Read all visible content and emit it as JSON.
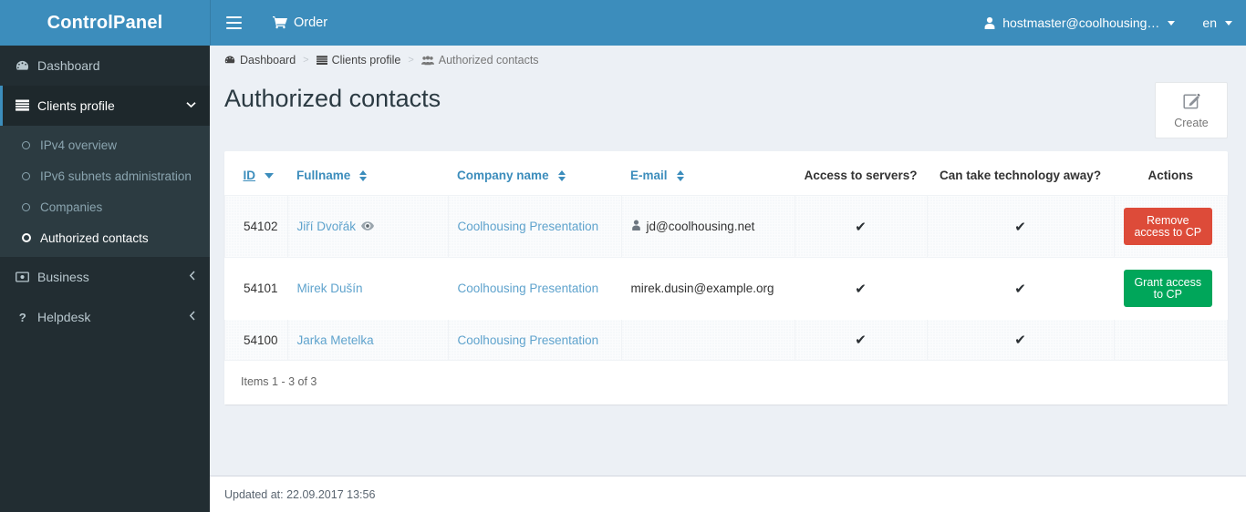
{
  "brand": {
    "title": "ControlPanel"
  },
  "navbar": {
    "menu_toggle": "menu-toggle",
    "order_label": "Order",
    "user_label": "hostmaster@coolhousing…",
    "lang_label": "en"
  },
  "sidebar": {
    "items": [
      {
        "label": "Dashboard",
        "icon": "dashboard-icon",
        "active": false
      },
      {
        "label": "Clients profile",
        "icon": "server-list-icon",
        "active": true,
        "arrow": "chevron-down"
      },
      {
        "label": "Business",
        "icon": "money-icon",
        "active": false,
        "arrow": "chevron-left"
      },
      {
        "label": "Helpdesk",
        "icon": "question-icon",
        "active": false,
        "arrow": "chevron-left"
      }
    ],
    "submenu": [
      {
        "label": "IPv4 overview",
        "active": false
      },
      {
        "label": "IPv6 subnets administration",
        "active": false
      },
      {
        "label": "Companies",
        "active": false
      },
      {
        "label": "Authorized contacts",
        "active": true
      }
    ]
  },
  "breadcrumb": [
    {
      "label": "Dashboard",
      "icon": "dashboard-icon"
    },
    {
      "label": "Clients profile",
      "icon": "server-list-icon"
    },
    {
      "label": "Authorized contacts",
      "icon": "users-group-icon"
    }
  ],
  "page": {
    "title": "Authorized contacts",
    "create_label": "Create"
  },
  "table": {
    "columns": [
      {
        "label": "ID",
        "sort": "desc",
        "align": "left",
        "underline": true
      },
      {
        "label": "Fullname",
        "sort": "both",
        "align": "left"
      },
      {
        "label": "Company name",
        "sort": "both",
        "align": "left"
      },
      {
        "label": "E-mail",
        "sort": "both",
        "align": "left"
      },
      {
        "label": "Access to servers?",
        "sort": "none",
        "align": "center"
      },
      {
        "label": "Can take technology away?",
        "sort": "none",
        "align": "center"
      },
      {
        "label": "Actions",
        "sort": "none",
        "align": "center"
      }
    ],
    "rows": [
      {
        "id": "54102",
        "fullname": "Jiří Dvořák",
        "has_eye": true,
        "company": "Coolhousing Presentation",
        "email": "jd@coolhousing.net",
        "email_has_person_icon": true,
        "access_servers": "✔",
        "take_away": "✔",
        "action_label": "Remove access to CP",
        "action_kind": "danger"
      },
      {
        "id": "54101",
        "fullname": "Mirek Dušín",
        "has_eye": false,
        "company": "Coolhousing Presentation",
        "email": "mirek.dusin@example.org",
        "email_has_person_icon": false,
        "access_servers": "✔",
        "take_away": "✔",
        "action_label": "Grant access to CP",
        "action_kind": "success"
      },
      {
        "id": "54100",
        "fullname": "Jarka Metelka",
        "has_eye": false,
        "company": "Coolhousing Presentation",
        "email": "",
        "email_has_person_icon": false,
        "access_servers": "✔",
        "take_away": "✔",
        "action_label": "",
        "action_kind": "none"
      }
    ],
    "footer_text": "Items 1 - 3 of 3"
  },
  "footer": {
    "updated_at": "Updated at: 22.09.2017 13:56"
  },
  "colors": {
    "brand_blue": "#3c8dbc",
    "sidebar_dark": "#222d32",
    "submenu_dark": "#2c3b41",
    "danger_red": "#dd4b39",
    "success_green": "#00a65a",
    "link_blue": "#5fa3cd",
    "page_bg": "#ecf0f5"
  }
}
